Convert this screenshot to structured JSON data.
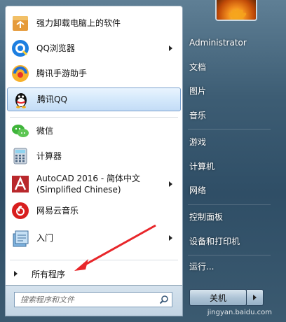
{
  "programs": [
    {
      "label": "强力卸载电脑上的软件",
      "icon": "uninstaller-icon",
      "submenu": false
    },
    {
      "label": "QQ浏览器",
      "icon": "qq-browser-icon",
      "submenu": true
    },
    {
      "label": "腾讯手游助手",
      "icon": "tencent-game-assistant-icon",
      "submenu": false
    },
    {
      "label": "腾讯QQ",
      "icon": "tencent-qq-icon",
      "submenu": false,
      "selected": true
    },
    {
      "label": "微信",
      "icon": "wechat-icon",
      "submenu": false
    },
    {
      "label": "计算器",
      "icon": "calculator-icon",
      "submenu": false
    },
    {
      "label": "AutoCAD 2016 - 简体中文",
      "label2": "(Simplified Chinese)",
      "icon": "autocad-icon",
      "submenu": true
    },
    {
      "label": "网易云音乐",
      "icon": "netease-music-icon",
      "submenu": false
    },
    {
      "label": "入门",
      "icon": "getting-started-icon",
      "submenu": true
    }
  ],
  "all_programs": "所有程序",
  "search": {
    "placeholder": "搜索程序和文件"
  },
  "right_menu": [
    "Administrator",
    "文档",
    "图片",
    "音乐",
    "游戏",
    "计算机",
    "网络",
    "控制面板",
    "设备和打印机",
    "运行..."
  ],
  "shutdown_label": "关机",
  "watermark": "jingyan.baidu.com",
  "colors": {
    "selection": "#c3dcf6",
    "annotation_arrow": "#e8262a"
  }
}
